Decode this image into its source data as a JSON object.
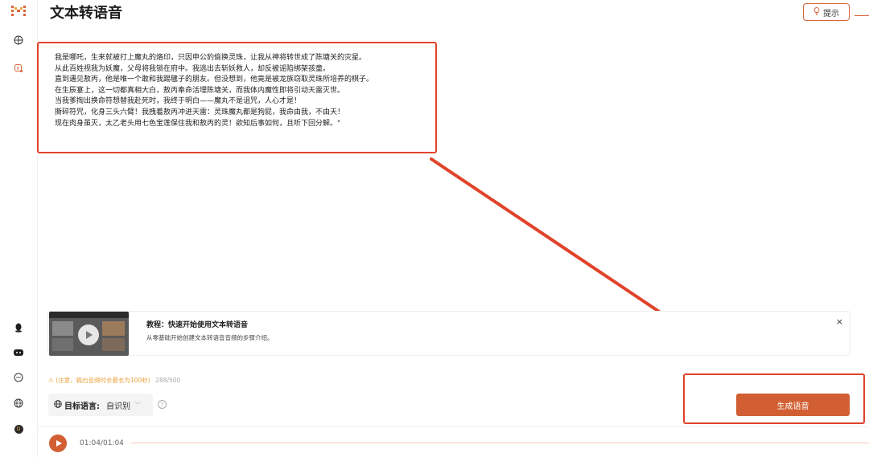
{
  "app": {
    "title": "文本转语音",
    "logo_text": "H"
  },
  "header": {
    "tip_label": "提示",
    "tip_icon": "lightbulb-icon"
  },
  "sidebar": {
    "top_icons": [
      "logo-icon",
      "sparkle-icon",
      "voice-icon"
    ],
    "bottom_icons": [
      "qq-icon",
      "discord-icon",
      "chat-icon",
      "globe-icon",
      "user-avatar-icon"
    ],
    "avatar_letter": "D"
  },
  "editor": {
    "lines": [
      "我是哪吒，生来就被打上魔丸的烙印，只因申公豹偷换灵珠，让我从神将转世成了陈塘关的灾星。",
      " 从此百姓视我为妖魔，父母将我锁在府中。我逃出去斩妖救人，却反被谣陷绑架孩童。",
      "直到遇见敖丙，他是唯一个敢和我踢毽子的朋友。但没想到，他竟是被龙族窃取灵珠所培养的棋子。",
      "在生辰宴上，这一切都真相大白，敖丙奉命活埋陈塘关，而我体内魔性即将引动天雷灭世。",
      "当我爹掏出换命符想替我赴死时，我终于明白——魔丸不是诅咒，人心才是！",
      "撕碎符咒，化身三头六臂！我拽着敖丙冲进天雷：灵珠魔丸都是狗屁，我命由我，不由天！",
      "现在肉身虽灭，太乙老头用七色宝莲保住我和敖丙的灵！欲知后事如何，且听下回分解。\""
    ]
  },
  "tutorial": {
    "title": "教程：快速开始使用文本转语音",
    "description": "从零基础开始创建文本转语音音频的步骤介绍。",
    "close": "×"
  },
  "notice": {
    "text": "⚠ (注意，输出音频时长最长为100秒)",
    "count": "288/500"
  },
  "language": {
    "label": "目标语言:",
    "value": "自识别"
  },
  "generate": {
    "label": "生成语音"
  },
  "player": {
    "time": "01:04/01:04",
    "progress": 0.0
  },
  "colors": {
    "accent": "#d25f33",
    "annotation": "#e0432b",
    "warning": "#e8a33d"
  }
}
